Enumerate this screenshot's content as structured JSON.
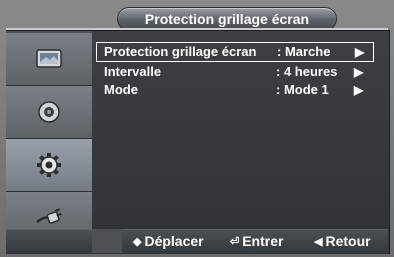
{
  "header": {
    "title": "Protection grillage écran"
  },
  "sidebar": {
    "items": [
      {
        "icon": "picture-icon"
      },
      {
        "icon": "sound-icon"
      },
      {
        "icon": "setup-gear-icon",
        "active": true
      },
      {
        "icon": "input-plug-icon"
      }
    ]
  },
  "menu": {
    "items": [
      {
        "label": "Protection grillage écran",
        "value": ": Marche",
        "arrow": "▶",
        "selected": true
      },
      {
        "label": "Intervalle",
        "value": ": 4 heures",
        "arrow": "▶"
      },
      {
        "label": "Mode",
        "value": ": Mode 1",
        "arrow": "▶"
      }
    ]
  },
  "footer": {
    "move": {
      "symbol": "◆",
      "label": "Déplacer"
    },
    "enter": {
      "symbol": "⏎",
      "label": "Entrer"
    },
    "back": {
      "symbol": "◀",
      "label": "Retour"
    }
  },
  "colors": {
    "panel": "#34383c",
    "highlight": "#ffffff",
    "text": "#ffffff"
  }
}
